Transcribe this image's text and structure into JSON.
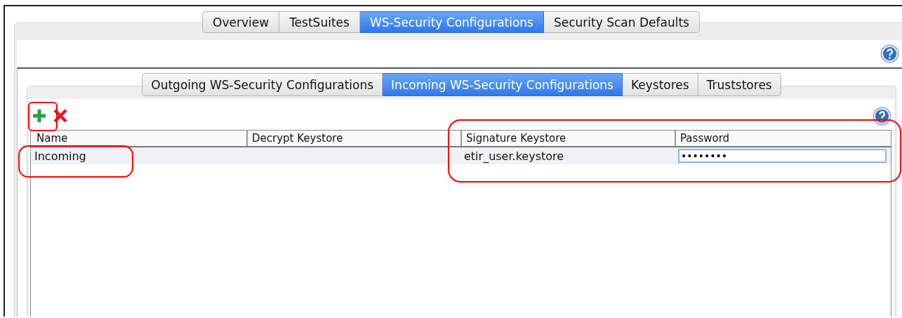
{
  "tabs": [
    {
      "label": "Overview",
      "selected": false
    },
    {
      "label": "TestSuites",
      "selected": false
    },
    {
      "label": "WS-Security Configurations",
      "selected": true
    },
    {
      "label": "Security Scan Defaults",
      "selected": false
    }
  ],
  "sub_tabs": [
    {
      "label": "Outgoing WS-Security Configurations",
      "selected": false
    },
    {
      "label": "Incoming WS-Security Configurations",
      "selected": true
    },
    {
      "label": "Keystores",
      "selected": false
    },
    {
      "label": "Truststores",
      "selected": false
    }
  ],
  "table": {
    "columns": [
      "Name",
      "Decrypt Keystore",
      "Signature Keystore",
      "Password"
    ],
    "rows": [
      {
        "name": "Incoming",
        "signature_keystore": "etir_user.keystore",
        "password": "••••••••",
        "editing": true
      }
    ]
  }
}
